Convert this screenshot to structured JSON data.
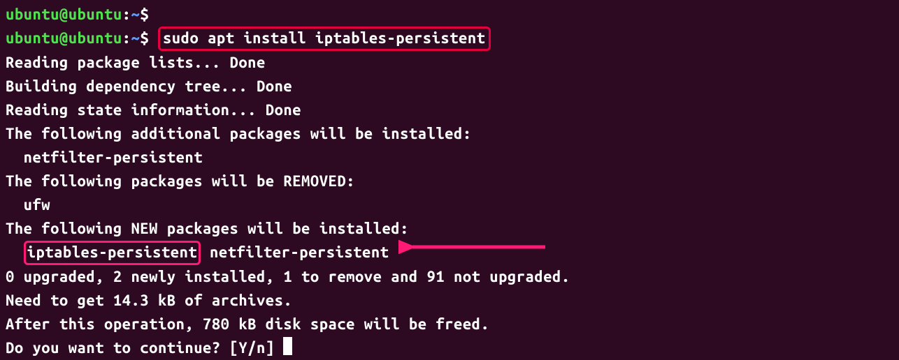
{
  "prompt": {
    "user": "ubuntu@ubuntu",
    "colon": ":",
    "path": "~",
    "dollar": "$"
  },
  "command": "sudo apt install iptables-persistent",
  "output": {
    "line1": "Reading package lists... Done",
    "line2": "Building dependency tree... Done",
    "line3": "Reading state information... Done",
    "line4": "The following additional packages will be installed:",
    "line5": "  netfilter-persistent",
    "line6": "The following packages will be REMOVED:",
    "line7": "  ufw",
    "line8": "The following NEW packages will be installed:",
    "line9_pkg1": "iptables-persistent",
    "line9_pkg2": " netfilter-persistent",
    "line10": "0 upgraded, 2 newly installed, 1 to remove and 91 not upgraded.",
    "line11": "Need to get 14.3 kB of archives.",
    "line12": "After this operation, 780 kB disk space will be freed.",
    "line13": "Do you want to continue? [Y/n] "
  }
}
